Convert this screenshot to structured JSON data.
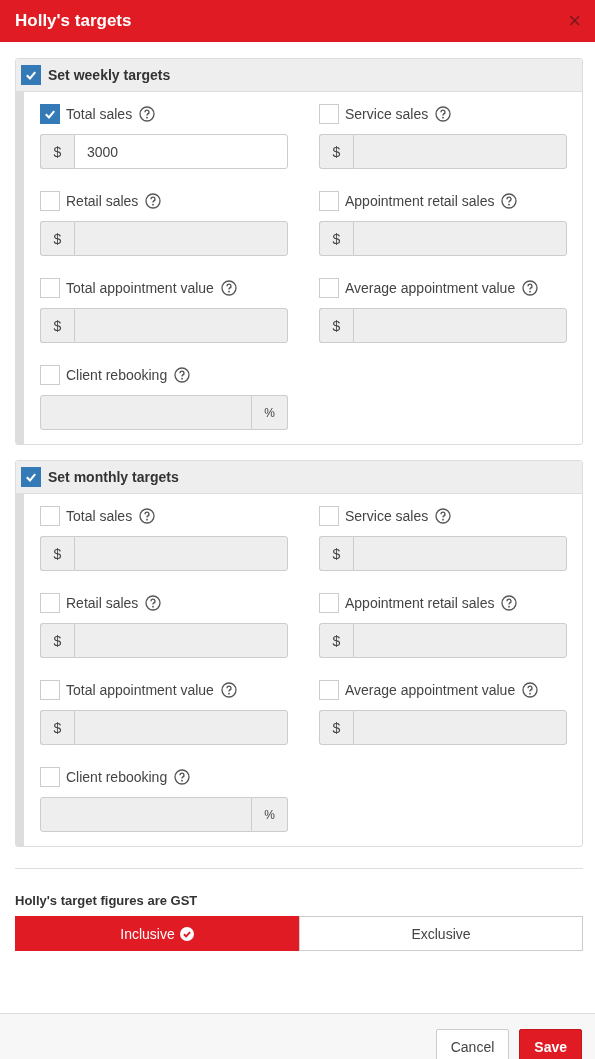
{
  "window": {
    "title": "Holly's targets",
    "close": "×"
  },
  "sections": [
    {
      "title": "Set weekly targets",
      "checked": true,
      "fields": [
        {
          "label": "Total sales",
          "checked": true,
          "kind": "money",
          "unit": "$",
          "value": "3000"
        },
        {
          "label": "Service sales",
          "checked": false,
          "kind": "money",
          "unit": "$"
        },
        {
          "label": "Retail sales",
          "checked": false,
          "kind": "money",
          "unit": "$"
        },
        {
          "label": "Appointment retail sales",
          "checked": false,
          "kind": "money",
          "unit": "$"
        },
        {
          "label": "Total appointment value",
          "checked": false,
          "kind": "money",
          "unit": "$"
        },
        {
          "label": "Average appointment value",
          "checked": false,
          "kind": "money",
          "unit": "$"
        },
        {
          "label": "Client rebooking",
          "checked": false,
          "kind": "percent",
          "unit": "%"
        }
      ]
    },
    {
      "title": "Set monthly targets",
      "checked": true,
      "fields": [
        {
          "label": "Total sales",
          "checked": false,
          "kind": "money",
          "unit": "$"
        },
        {
          "label": "Service sales",
          "checked": false,
          "kind": "money",
          "unit": "$"
        },
        {
          "label": "Retail sales",
          "checked": false,
          "kind": "money",
          "unit": "$"
        },
        {
          "label": "Appointment retail sales",
          "checked": false,
          "kind": "money",
          "unit": "$"
        },
        {
          "label": "Total appointment value",
          "checked": false,
          "kind": "money",
          "unit": "$"
        },
        {
          "label": "Average appointment value",
          "checked": false,
          "kind": "money",
          "unit": "$"
        },
        {
          "label": "Client rebooking",
          "checked": false,
          "kind": "percent",
          "unit": "%"
        }
      ]
    }
  ],
  "gst": {
    "label": "Holly's target figures are GST",
    "options": [
      {
        "label": "Inclusive",
        "selected": true
      },
      {
        "label": "Exclusive",
        "selected": false
      }
    ]
  },
  "buttons": [
    {
      "label": "Cancel",
      "kind": "secondary"
    },
    {
      "label": "Save",
      "kind": "primary"
    }
  ]
}
